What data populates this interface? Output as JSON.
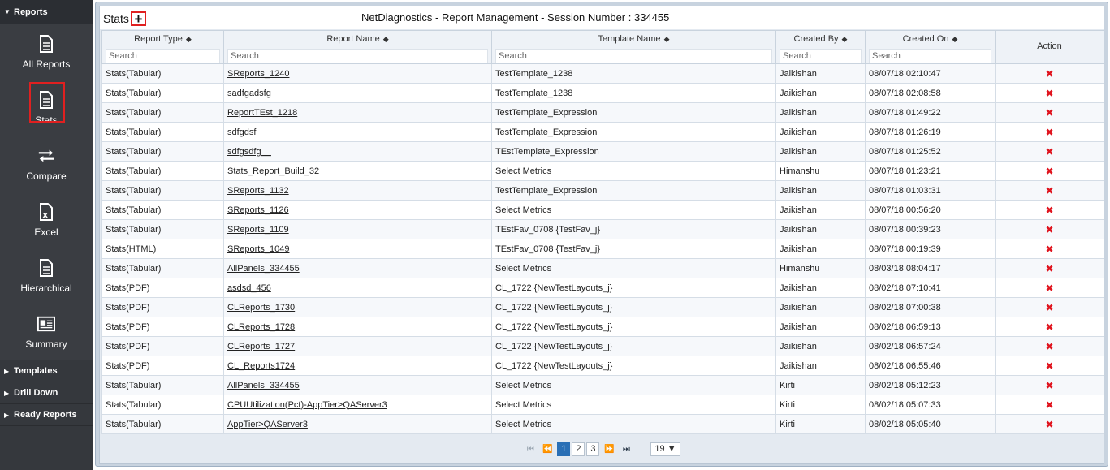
{
  "sidebar": {
    "sections_top": {
      "label": "Reports",
      "expanded": true
    },
    "items": [
      {
        "key": "all-reports",
        "label": "All Reports",
        "icon": "document-icon",
        "active": false
      },
      {
        "key": "stats",
        "label": "Stats",
        "icon": "document-icon",
        "active": true
      },
      {
        "key": "compare",
        "label": "Compare",
        "icon": "swap-arrows-icon",
        "active": false
      },
      {
        "key": "excel",
        "label": "Excel",
        "icon": "excel-icon",
        "active": false
      },
      {
        "key": "hierarchical",
        "label": "Hierarchical",
        "icon": "document-icon",
        "active": false
      },
      {
        "key": "summary",
        "label": "Summary",
        "icon": "summary-card-icon",
        "active": false
      }
    ],
    "sections_bottom": [
      {
        "label": "Templates"
      },
      {
        "label": "Drill Down"
      },
      {
        "label": "Ready Reports"
      }
    ]
  },
  "header": {
    "section_title": "Stats",
    "add_symbol": "+",
    "title": "NetDiagnostics - Report Management - Session Number : 334455"
  },
  "table": {
    "columns": [
      {
        "label": "Report Type",
        "sortable": true,
        "placeholder": "Search"
      },
      {
        "label": "Report Name",
        "sortable": true,
        "placeholder": "Search"
      },
      {
        "label": "Template Name",
        "sortable": true,
        "placeholder": "Search"
      },
      {
        "label": "Created By",
        "sortable": true,
        "placeholder": "Search"
      },
      {
        "label": "Created On",
        "sortable": true,
        "placeholder": "Search"
      },
      {
        "label": "Action",
        "sortable": false
      }
    ],
    "rows": [
      {
        "type": "Stats(Tabular)",
        "name": "SReports_1240",
        "template": "TestTemplate_1238",
        "by": "Jaikishan",
        "on": "08/07/18 02:10:47"
      },
      {
        "type": "Stats(Tabular)",
        "name": "sadfgadsfg",
        "template": "TestTemplate_1238",
        "by": "Jaikishan",
        "on": "08/07/18 02:08:58"
      },
      {
        "type": "Stats(Tabular)",
        "name": "ReportTEst_1218",
        "template": "TestTemplate_Expression",
        "by": "Jaikishan",
        "on": "08/07/18 01:49:22"
      },
      {
        "type": "Stats(Tabular)",
        "name": "sdfgdsf",
        "template": "TestTemplate_Expression",
        "by": "Jaikishan",
        "on": "08/07/18 01:26:19"
      },
      {
        "type": "Stats(Tabular)",
        "name": "sdfgsdfg__",
        "template": "TEstTemplate_Expression",
        "by": "Jaikishan",
        "on": "08/07/18 01:25:52"
      },
      {
        "type": "Stats(Tabular)",
        "name": "Stats_Report_Build_32",
        "template": "Select Metrics",
        "by": "Himanshu",
        "on": "08/07/18 01:23:21"
      },
      {
        "type": "Stats(Tabular)",
        "name": "SReports_1132",
        "template": "TestTemplate_Expression",
        "by": "Jaikishan",
        "on": "08/07/18 01:03:31"
      },
      {
        "type": "Stats(Tabular)",
        "name": "SReports_1126",
        "template": "Select Metrics",
        "by": "Jaikishan",
        "on": "08/07/18 00:56:20"
      },
      {
        "type": "Stats(Tabular)",
        "name": "SReports_1109",
        "template": "TEstFav_0708 {TestFav_j}",
        "by": "Jaikishan",
        "on": "08/07/18 00:39:23"
      },
      {
        "type": "Stats(HTML)",
        "name": "SReports_1049",
        "template": "TEstFav_0708 {TestFav_j}",
        "by": "Jaikishan",
        "on": "08/07/18 00:19:39"
      },
      {
        "type": "Stats(Tabular)",
        "name": "AllPanels_334455",
        "template": "Select Metrics",
        "by": "Himanshu",
        "on": "08/03/18 08:04:17"
      },
      {
        "type": "Stats(PDF)",
        "name": "asdsd_456",
        "template": "CL_1722 {NewTestLayouts_j}",
        "by": "Jaikishan",
        "on": "08/02/18 07:10:41"
      },
      {
        "type": "Stats(PDF)",
        "name": "CLReports_1730",
        "template": "CL_1722 {NewTestLayouts_j}",
        "by": "Jaikishan",
        "on": "08/02/18 07:00:38"
      },
      {
        "type": "Stats(PDF)",
        "name": "CLReports_1728",
        "template": "CL_1722 {NewTestLayouts_j}",
        "by": "Jaikishan",
        "on": "08/02/18 06:59:13"
      },
      {
        "type": "Stats(PDF)",
        "name": "CLReports_1727",
        "template": "CL_1722 {NewTestLayouts_j}",
        "by": "Jaikishan",
        "on": "08/02/18 06:57:24"
      },
      {
        "type": "Stats(PDF)",
        "name": "CL_Reports1724",
        "template": "CL_1722 {NewTestLayouts_j}",
        "by": "Jaikishan",
        "on": "08/02/18 06:55:46"
      },
      {
        "type": "Stats(Tabular)",
        "name": "AllPanels_334455",
        "template": "Select Metrics",
        "by": "Kirti",
        "on": "08/02/18 05:12:23"
      },
      {
        "type": "Stats(Tabular)",
        "name": "CPUUtilization(Pct)-AppTier>QAServer3",
        "template": "Select Metrics",
        "by": "Kirti",
        "on": "08/02/18 05:07:33"
      },
      {
        "type": "Stats(Tabular)",
        "name": "AppTier>QAServer3",
        "template": "Select Metrics",
        "by": "Kirti",
        "on": "08/02/18 05:05:40"
      }
    ],
    "delete_symbol": "✖"
  },
  "pager": {
    "pages": [
      "1",
      "2",
      "3"
    ],
    "current_page": "1",
    "rows_per_page": "19",
    "colors": {
      "active": "#2a6fb5"
    }
  },
  "colors": {
    "sidebar_bg": "#35383d",
    "highlight_border": "#e02020",
    "delete_icon": "#e0141e"
  }
}
